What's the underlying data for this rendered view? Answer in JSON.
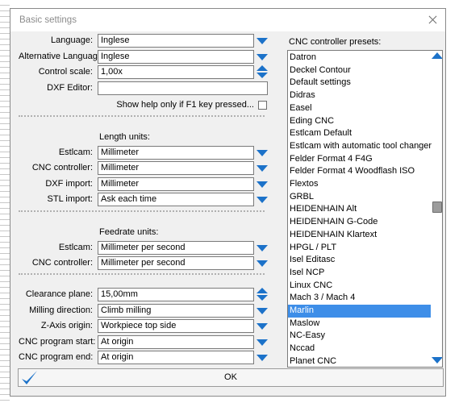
{
  "window": {
    "title": "Basic settings"
  },
  "general": {
    "language": {
      "label": "Language:",
      "value": "Inglese"
    },
    "alt_language": {
      "label": "Alternative Language:",
      "value": "Inglese"
    },
    "control_scale": {
      "label": "Control scale:",
      "value": "1,00x"
    },
    "dxf_editor": {
      "label": "DXF Editor:",
      "value": ""
    },
    "help_checkbox": {
      "label": "Show help only if F1 key pressed...",
      "checked": false
    }
  },
  "length_units": {
    "title": "Length units:",
    "estlcam": {
      "label": "Estlcam:",
      "value": "Millimeter"
    },
    "cnc_controller": {
      "label": "CNC controller:",
      "value": "Millimeter"
    },
    "dxf_import": {
      "label": "DXF import:",
      "value": "Millimeter"
    },
    "stl_import": {
      "label": "STL import:",
      "value": "Ask each time"
    }
  },
  "feedrate_units": {
    "title": "Feedrate units:",
    "estlcam": {
      "label": "Estlcam:",
      "value": "Millimeter per second"
    },
    "cnc_controller": {
      "label": "CNC controller:",
      "value": "Millimeter per second"
    }
  },
  "program": {
    "clearance_plane": {
      "label": "Clearance plane:",
      "value": "15,00mm"
    },
    "milling_direction": {
      "label": "Milling direction:",
      "value": "Climb milling"
    },
    "z_axis_origin": {
      "label": "Z-Axis origin:",
      "value": "Workpiece top side"
    },
    "program_start": {
      "label": "CNC program start:",
      "value": "At origin"
    },
    "program_end": {
      "label": "CNC program end:",
      "value": "At origin"
    }
  },
  "presets": {
    "title": "CNC controller presets:",
    "selected": "Marlin",
    "items": [
      "Datron",
      "Deckel Contour",
      "Default settings",
      "Didras",
      "Easel",
      "Eding CNC",
      "Estlcam Default",
      "Estlcam with automatic tool changer",
      "Felder Format 4 F4G",
      "Felder Format 4 Woodflash ISO",
      "Flextos",
      "GRBL",
      "HEIDENHAIN Alt",
      "HEIDENHAIN G-Code",
      "HEIDENHAIN Klartext",
      "HPGL / PLT",
      "Isel Editasc",
      "Isel NCP",
      "Linux CNC",
      "Mach 3 / Mach 4",
      "Marlin",
      "Maslow",
      "NC-Easy",
      "Nccad",
      "Planet CNC"
    ]
  },
  "ok_button": {
    "label": "OK"
  },
  "colors": {
    "accent": "#1c72c9",
    "selection": "#3e8ee8",
    "window_bg": "#f0f0f0"
  }
}
